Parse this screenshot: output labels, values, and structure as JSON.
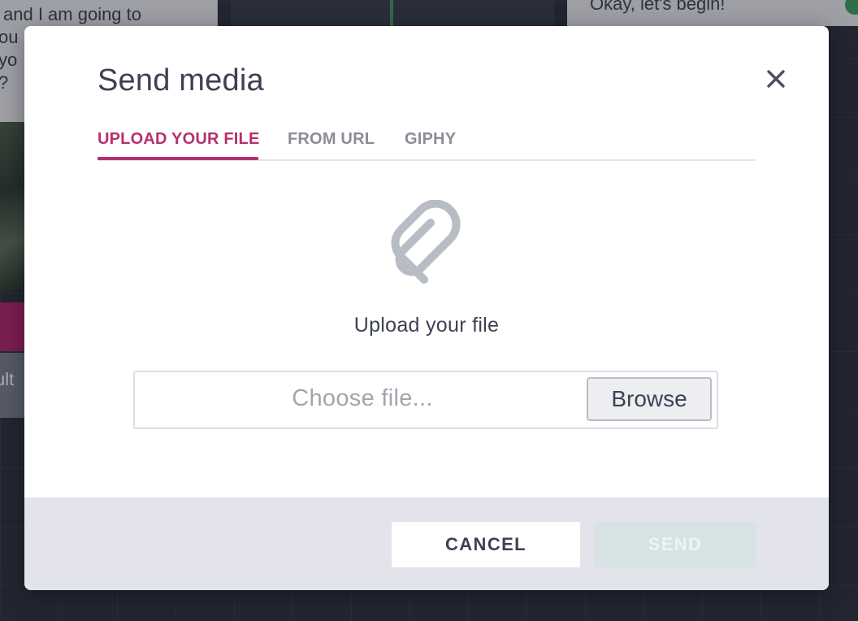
{
  "background": {
    "left_message_lines": [
      "and I am going to",
      "ou",
      "yo",
      "?"
    ],
    "left_button_fragment": "ult",
    "right_message": "Okay, let's begin!"
  },
  "modal": {
    "title": "Send media",
    "close_icon": "close-icon",
    "tabs": [
      {
        "label": "UPLOAD YOUR FILE",
        "active": true
      },
      {
        "label": "FROM URL",
        "active": false
      },
      {
        "label": "GIPHY",
        "active": false
      }
    ],
    "upload_icon": "paperclip-icon",
    "upload_label": "Upload your file",
    "file_input": {
      "placeholder": "Choose file...",
      "browse_label": "Browse"
    },
    "footer": {
      "cancel_label": "CANCEL",
      "send_label": "SEND",
      "send_enabled": false
    }
  },
  "colors": {
    "accent": "#b5306f",
    "text": "#3d4152",
    "footer_bg": "#e3e3ec",
    "send_disabled_bg": "#d6e3e2"
  }
}
